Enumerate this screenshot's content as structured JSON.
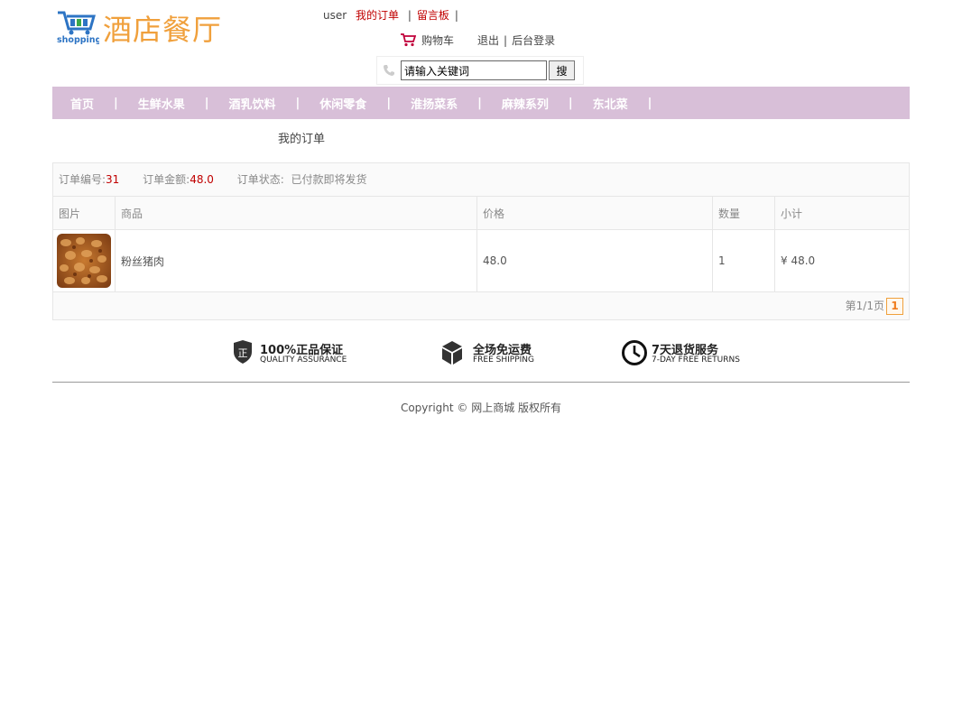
{
  "header": {
    "logo_text": "酒店餐厅",
    "logo_icon": "shopping-cart-icon",
    "user_name": "user",
    "my_orders": "我的订单",
    "message_board": "留言板",
    "separator": "|",
    "cart_label": "购物车",
    "logout": "退出",
    "admin_login": "后台登录"
  },
  "search": {
    "value": "请输入关键词",
    "button": "搜"
  },
  "nav": {
    "items": [
      "首页",
      "生鲜水果",
      "酒乳饮料",
      "休闲零食",
      "淮扬菜系",
      "麻辣系列",
      "东北菜"
    ],
    "separator": "|"
  },
  "page": {
    "title": "我的订单"
  },
  "order": {
    "number_label": "订单编号:",
    "number_value": "31",
    "amount_label": "订单金额:",
    "amount_value": "48.0",
    "status_label": "订单状态:",
    "status_value": "已付款即将发货",
    "columns": [
      "图片",
      "商品",
      "价格",
      "数量",
      "小计"
    ],
    "rows": [
      {
        "name": "粉丝猪肉",
        "price": "48.0",
        "quantity": "1",
        "subtotal": "¥ 48.0"
      }
    ],
    "pager_text": "第1/1页",
    "pager_current": "1"
  },
  "guarantees": [
    {
      "title": "100%正品保证",
      "subtitle": "QUALITY ASSURANCE",
      "icon": "shield-icon"
    },
    {
      "title": "全场免运费",
      "subtitle": "FREE SHIPPING",
      "icon": "box-icon"
    },
    {
      "title": "7天退货服务",
      "subtitle": "7-DAY FREE RETURNS",
      "icon": "clock-icon"
    }
  ],
  "footer": {
    "copyright": "Copyright © 网上商城 版权所有"
  },
  "colors": {
    "nav_bg": "#d8bfd8",
    "accent_red": "#c00000",
    "logo_orange": "#f0a03c"
  }
}
